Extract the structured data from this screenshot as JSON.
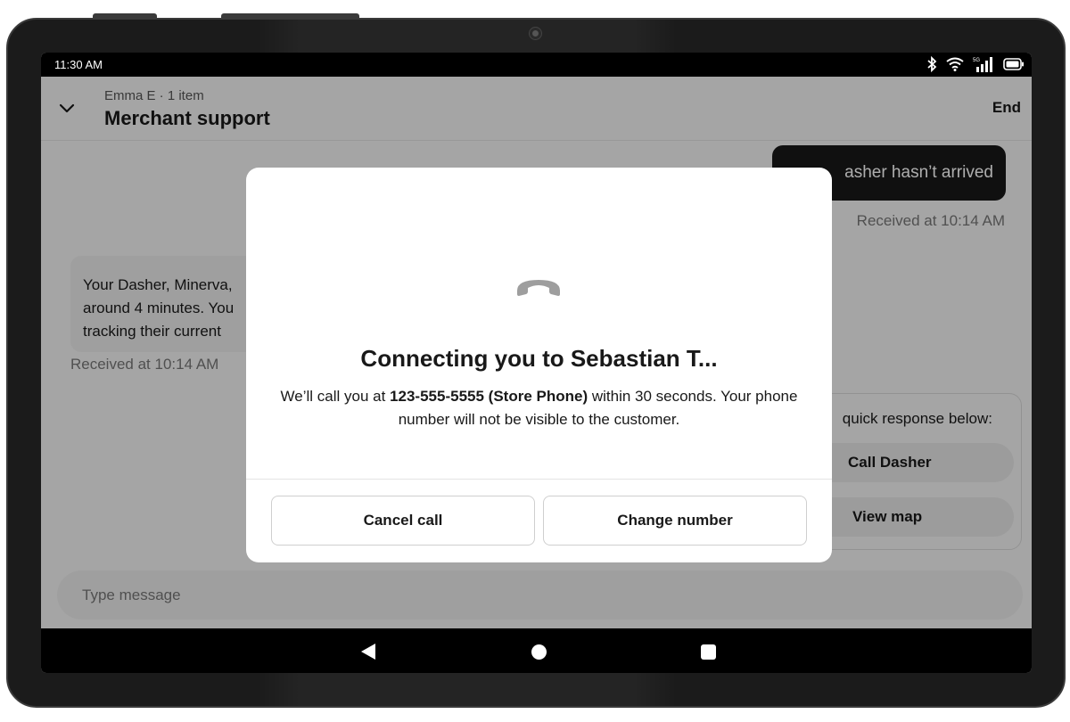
{
  "status_bar": {
    "time": "11:30 AM",
    "icons": [
      "bluetooth-icon",
      "wifi-icon",
      "signal-5g-icon",
      "battery-icon"
    ],
    "signal_label": "5G"
  },
  "header": {
    "subtitle": "Emma E · 1 item",
    "title": "Merchant support",
    "end_label": "End",
    "collapse_icon": "chevron-down-icon"
  },
  "chat": {
    "outgoing_message": "asher hasn’t arrived",
    "outgoing_received": "Received at 10:14 AM",
    "incoming_lines": [
      "Your Dasher, Minerva,",
      "around 4 minutes. You",
      "tracking their current"
    ],
    "incoming_received": "Received at 10:14 AM"
  },
  "quick_responses": {
    "prompt": "quick response below:",
    "buttons": [
      "Call Dasher",
      "View map"
    ]
  },
  "composer": {
    "placeholder": "Type message"
  },
  "dialog": {
    "icon": "phone-hangup-icon",
    "title": "Connecting you to Sebastian T...",
    "body_prefix": "We’ll call you at ",
    "phone": "123-555-5555 (Store Phone)",
    "body_suffix": " within 30 seconds. Your phone number will not be visible to the customer.",
    "cancel_label": "Cancel call",
    "change_label": "Change number"
  },
  "nav_bar": {
    "icons": [
      "back-icon",
      "home-icon",
      "recents-icon"
    ]
  },
  "colors": {
    "primary_text": "#191919",
    "secondary_text": "#767676",
    "frame": "#1b1b1b",
    "overlay": "rgba(0,0,0,0.32)"
  }
}
